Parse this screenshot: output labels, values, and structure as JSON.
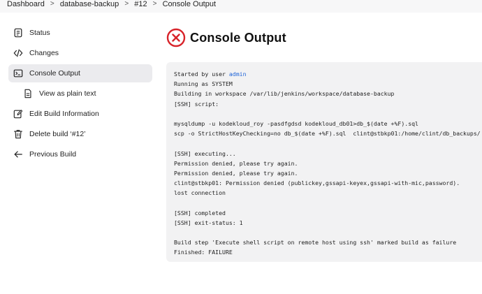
{
  "breadcrumb": {
    "items": [
      "Dashboard",
      "database-backup",
      "#12",
      "Console Output"
    ],
    "separator": ">"
  },
  "sidebar": {
    "items": [
      {
        "label": "Status",
        "icon": "status-icon"
      },
      {
        "label": "Changes",
        "icon": "code-icon"
      },
      {
        "label": "Console Output",
        "icon": "terminal-icon",
        "active": true
      },
      {
        "label": "View as plain text",
        "icon": "document-icon",
        "sub": true
      },
      {
        "label": "Edit Build Information",
        "icon": "edit-icon"
      },
      {
        "label": "Delete build ‘#12’",
        "icon": "trash-icon"
      },
      {
        "label": "Previous Build",
        "icon": "arrow-left-icon"
      }
    ]
  },
  "page": {
    "title": "Console Output",
    "status_icon": "failure-icon",
    "status_color": "#d8232a"
  },
  "console": {
    "started_prefix": "Started by user ",
    "user": "admin",
    "lines": [
      "Running as SYSTEM",
      "Building in workspace /var/lib/jenkins/workspace/database-backup",
      "[SSH] script:",
      "",
      "mysqldump -u kodekloud_roy -pasdfgdsd kodekloud_db01>db_$(date +%F).sql",
      "scp -o StrictHostKeyChecking=no db_$(date +%F).sql  clint@stbkp01:/home/clint/db_backups/",
      "",
      "[SSH] executing...",
      "Permission denied, please try again.",
      "Permission denied, please try again.",
      "clint@stbkp01: Permission denied (publickey,gssapi-keyex,gssapi-with-mic,password).",
      "lost connection",
      "",
      "[SSH] completed",
      "[SSH] exit-status: 1",
      "",
      "Build step 'Execute shell script on remote host using ssh' marked build as failure",
      "Finished: FAILURE"
    ]
  }
}
